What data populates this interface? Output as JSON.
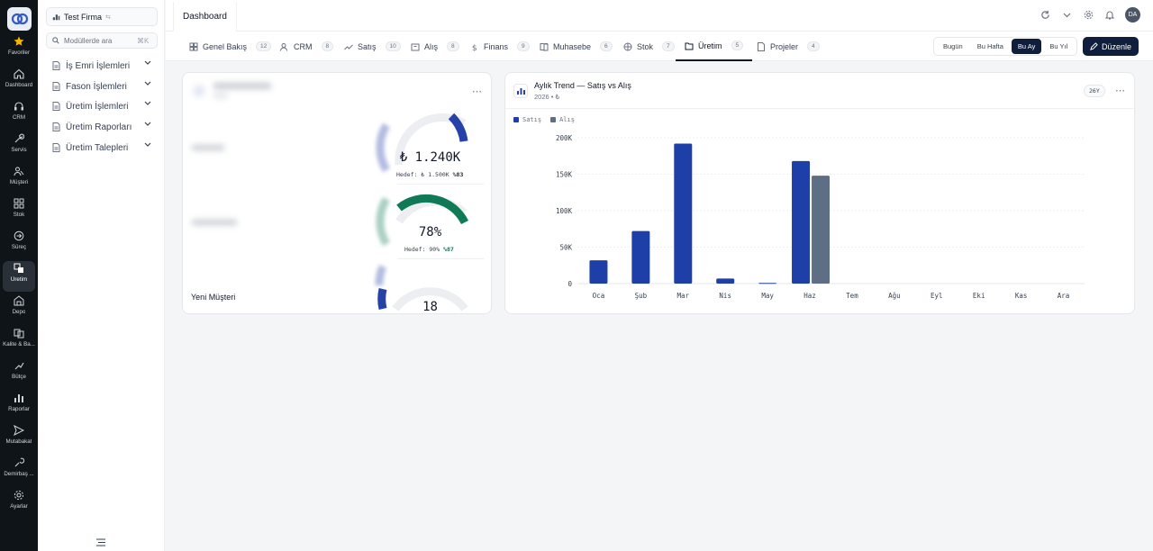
{
  "rail": {
    "items": [
      {
        "label": "Favoriler",
        "icon": "star-icon"
      },
      {
        "label": "Dashboard",
        "icon": "home-icon"
      },
      {
        "label": "CRM",
        "icon": "headset-icon"
      },
      {
        "label": "Servis",
        "icon": "wrench-icon"
      },
      {
        "label": "Müşteri",
        "icon": "users-icon"
      },
      {
        "label": "Stok",
        "icon": "grid-icon"
      },
      {
        "label": "Süreç",
        "icon": "process-icon"
      },
      {
        "label": "Üretim",
        "icon": "production-icon"
      },
      {
        "label": "Depo",
        "icon": "warehouse-icon"
      },
      {
        "label": "Kalite & Ba...",
        "icon": "quality-icon"
      },
      {
        "label": "Bütçe",
        "icon": "budget-icon"
      },
      {
        "label": "Raporlar",
        "icon": "report-icon"
      },
      {
        "label": "Mutabakat",
        "icon": "send-icon"
      },
      {
        "label": "Demirbaş ...",
        "icon": "asset-icon"
      },
      {
        "label": "Ayarlar",
        "icon": "gear-icon"
      }
    ]
  },
  "sidebar": {
    "firm": "Test Firma",
    "search_placeholder": "Modüllerde ara",
    "search_shortcut": "⌘K",
    "items": [
      {
        "label": "İş Emri İşlemleri"
      },
      {
        "label": "Fason İşlemleri"
      },
      {
        "label": "Üretim İşlemleri"
      },
      {
        "label": "Üretim Raporları"
      },
      {
        "label": "Üretim Talepleri"
      }
    ]
  },
  "topbar": {
    "tab": "Dashboard",
    "avatar": "DA"
  },
  "tabs": [
    {
      "label": "Genel Bakış",
      "count": "12"
    },
    {
      "label": "CRM",
      "count": "8"
    },
    {
      "label": "Satış",
      "count": "10"
    },
    {
      "label": "Alış",
      "count": "8"
    },
    {
      "label": "Finans",
      "count": "9"
    },
    {
      "label": "Muhasebe",
      "count": "6"
    },
    {
      "label": "Stok",
      "count": "7"
    },
    {
      "label": "Üretim",
      "count": "5"
    },
    {
      "label": "Projeler",
      "count": "4"
    }
  ],
  "periods": [
    "Bugün",
    "Bu Hafta",
    "Bu Ay",
    "Bu Yıl"
  ],
  "active_period": "Bu Ay",
  "edit_label": "Düzenle",
  "kpi": {
    "g1_value": "₺ 1.240K",
    "g1_target": "Hedef: ₺ 1.500K",
    "g1_pct": "%83",
    "g2_value": "78%",
    "g2_target": "Hedef: 90%",
    "g2_pct": "%87",
    "g3_label": "Yeni Müşteri",
    "g3_value": "18",
    "colors": {
      "blue": "#2642a8",
      "green": "#0f7a55",
      "track": "#eceef1"
    }
  },
  "trend": {
    "title": "Aylık Trend — Satış vs Alış",
    "subtitle": "2026 • ₺",
    "badge": "26Y"
  },
  "chart_data": {
    "type": "bar",
    "categories": [
      "Oca",
      "Şub",
      "Mar",
      "Nis",
      "May",
      "Haz",
      "Tem",
      "Ağu",
      "Eyl",
      "Eki",
      "Kas",
      "Ara"
    ],
    "series": [
      {
        "name": "Satış",
        "color": "#1e3fa8",
        "values": [
          32000,
          72000,
          192000,
          7000,
          1000,
          168000,
          0,
          0,
          0,
          0,
          0,
          0
        ]
      },
      {
        "name": "Alış",
        "color": "#5e6f85",
        "values": [
          0,
          0,
          0,
          0,
          0,
          148000,
          0,
          0,
          0,
          0,
          0,
          0
        ]
      }
    ],
    "yticks": [
      "200K",
      "150K",
      "100K",
      "50K",
      "0"
    ],
    "ylim": [
      0,
      200000
    ],
    "grid": true,
    "legend": "top-left"
  }
}
